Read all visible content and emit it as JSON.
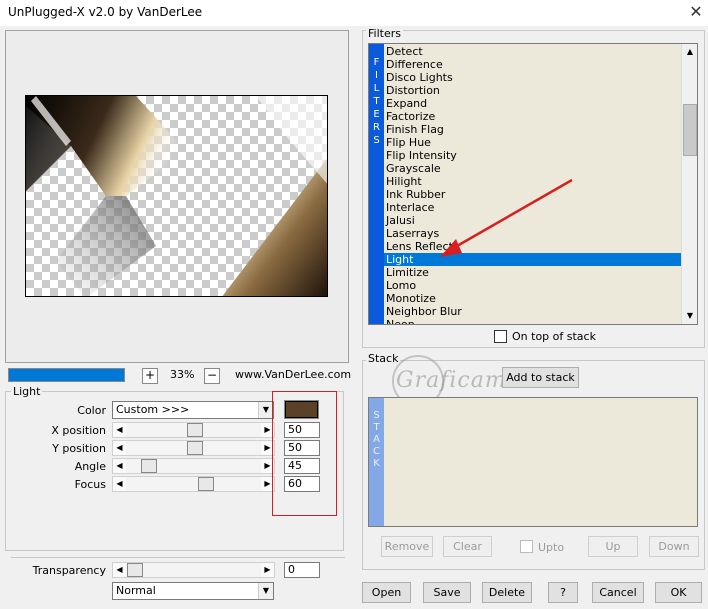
{
  "window": {
    "title": "UnPlugged-X v2.0 by VanDerLee",
    "close_glyph": "✕"
  },
  "preview": {
    "zoom_plus": "+",
    "zoom_value": "33%",
    "zoom_minus": "−",
    "website": "www.VanDerLee.com"
  },
  "light": {
    "group_label": "Light",
    "color_label": "Color",
    "color_value": "Custom >>>",
    "color_swatch": "#5c4129",
    "params": [
      {
        "label": "X position",
        "value": "50",
        "slider": 0.5
      },
      {
        "label": "Y position",
        "value": "50",
        "slider": 0.5
      },
      {
        "label": "Angle",
        "value": "45",
        "slider": 0.12
      },
      {
        "label": "Focus",
        "value": "60",
        "slider": 0.6
      }
    ]
  },
  "transparency": {
    "label": "Transparency",
    "value": "0",
    "slider": 0.0,
    "blend_mode": "Normal"
  },
  "filters": {
    "group_label": "Filters",
    "vertical_label": [
      "F",
      "I",
      "L",
      "T",
      "E",
      "R",
      "S"
    ],
    "items": [
      "Detect",
      "Difference",
      "Disco Lights",
      "Distortion",
      "Expand",
      "Factorize",
      "Finish Flag",
      "Flip Hue",
      "Flip Intensity",
      "Grayscale",
      "Hilight",
      "Ink Rubber",
      "Interlace",
      "Jalusi",
      "Laserrays",
      "Lens Reflect",
      "Light",
      "Limitize",
      "Lomo",
      "Monotize",
      "Neighbor Blur",
      "Neon"
    ],
    "selected": "Light",
    "on_top_label": "On top of stack",
    "on_top_checked": false
  },
  "stack": {
    "group_label": "Stack",
    "add_label": "Add to stack",
    "vertical_label": [
      "S",
      "T",
      "A",
      "C",
      "K"
    ],
    "remove_label": "Remove",
    "clear_label": "Clear",
    "upto_label": "Upto",
    "up_label": "Up",
    "down_label": "Down"
  },
  "watermark": "Graficamia",
  "footer": {
    "open": "Open",
    "save": "Save",
    "delete": "Delete",
    "help": "?",
    "cancel": "Cancel",
    "ok": "OK"
  },
  "colors": {
    "accent": "#0078d7",
    "filter_bar": "#0a5adb",
    "stack_bar": "#82a9e6",
    "annotation": "#d81f1f"
  }
}
